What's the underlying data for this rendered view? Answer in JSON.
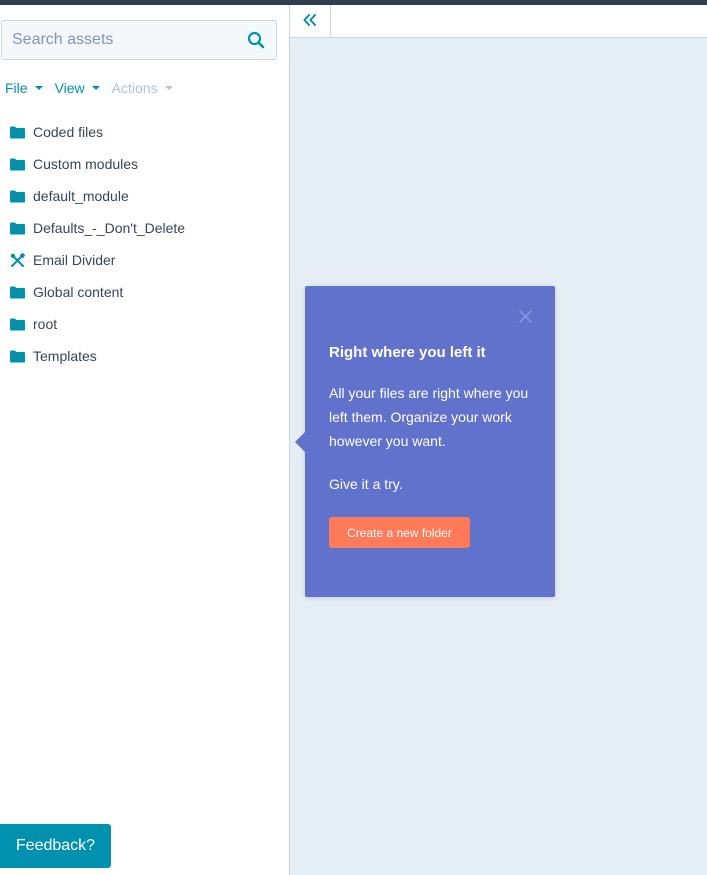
{
  "search": {
    "placeholder": "Search assets"
  },
  "menu": {
    "file": "File",
    "view": "View",
    "actions": "Actions"
  },
  "tree": {
    "items": [
      {
        "label": "Coded files",
        "icon": "folder-icon"
      },
      {
        "label": "Custom modules",
        "icon": "folder-icon"
      },
      {
        "label": "default_module",
        "icon": "folder-icon"
      },
      {
        "label": "Defaults_-_Don't_Delete",
        "icon": "folder-icon"
      },
      {
        "label": "Email Divider",
        "icon": "module-icon"
      },
      {
        "label": "Global content",
        "icon": "folder-icon"
      },
      {
        "label": "root",
        "icon": "folder-icon"
      },
      {
        "label": "Templates",
        "icon": "folder-icon"
      }
    ]
  },
  "feedback": {
    "label": "Feedback?"
  },
  "popover": {
    "title": "Right where you left it",
    "body": "All your files are right where you left them. Organize your work however you want.",
    "body2": "Give it a try.",
    "cta": "Create a new folder"
  },
  "colors": {
    "accent": "#0091ae",
    "popover_bg": "#6172cc",
    "cta_bg": "#ff7a59",
    "main_bg": "#e5edf5",
    "text": "#33475b"
  }
}
